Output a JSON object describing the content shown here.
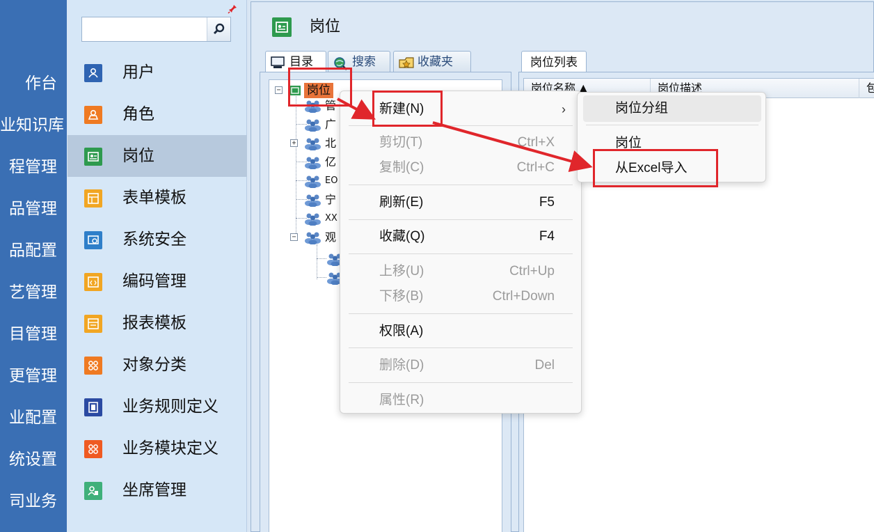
{
  "left_nav": {
    "items": [
      "作台",
      "业知识库",
      "程管理",
      "品管理",
      "品配置",
      "艺管理",
      "目管理",
      "更管理",
      "业配置",
      "统设置",
      "司业务"
    ]
  },
  "module_panel": {
    "search": {
      "value": "",
      "placeholder": ""
    },
    "modules": [
      {
        "label": "用户",
        "icon": "user-icon",
        "color": "#2f64b2"
      },
      {
        "label": "角色",
        "icon": "role-icon",
        "color": "#ef7a22"
      },
      {
        "label": "岗位",
        "icon": "position-icon",
        "color": "#2e9a4e"
      },
      {
        "label": "表单模板",
        "icon": "form-template-icon",
        "color": "#f1a623"
      },
      {
        "label": "系统安全",
        "icon": "security-icon",
        "color": "#2f7fc9"
      },
      {
        "label": "编码管理",
        "icon": "code-icon",
        "color": "#f1a623"
      },
      {
        "label": "报表模板",
        "icon": "report-template-icon",
        "color": "#f1a623"
      },
      {
        "label": "对象分类",
        "icon": "category-icon",
        "color": "#ef7a22"
      },
      {
        "label": "业务规则定义",
        "icon": "rule-icon",
        "color": "#2b4aa2"
      },
      {
        "label": "业务模块定义",
        "icon": "module-icon",
        "color": "#ef5a22"
      },
      {
        "label": "坐席管理",
        "icon": "seat-icon",
        "color": "#3fb07a"
      }
    ]
  },
  "content": {
    "title": "岗位",
    "left_tabs": [
      {
        "label": "目录",
        "icon": "catalog-icon"
      },
      {
        "label": "搜索",
        "icon": "search-globe-icon"
      },
      {
        "label": "收藏夹",
        "icon": "favorites-icon"
      }
    ],
    "tree": {
      "root": "岗位",
      "children": [
        "管",
        "广",
        "北",
        "亿",
        "EO",
        "宁",
        "XX",
        "观"
      ],
      "grandchildren": [
        "",
        ""
      ]
    },
    "right_tab": "岗位列表",
    "grid_columns": [
      "岗位名称 ▲",
      "岗位描述",
      "包"
    ]
  },
  "context_menu": {
    "items": [
      {
        "label": "新建(N)",
        "shortcut": "",
        "disabled": false,
        "submenu": true
      },
      {
        "label": "剪切(T)",
        "shortcut": "Ctrl+X",
        "disabled": true
      },
      {
        "label": "复制(C)",
        "shortcut": "Ctrl+C",
        "disabled": true
      },
      {
        "label": "刷新(E)",
        "shortcut": "F5",
        "disabled": false
      },
      {
        "label": "收藏(Q)",
        "shortcut": "F4",
        "disabled": false
      },
      {
        "label": "上移(U)",
        "shortcut": "Ctrl+Up",
        "disabled": true
      },
      {
        "label": "下移(B)",
        "shortcut": "Ctrl+Down",
        "disabled": true
      },
      {
        "label": "权限(A)",
        "shortcut": "",
        "disabled": false
      },
      {
        "label": "删除(D)",
        "shortcut": "Del",
        "disabled": true
      },
      {
        "label": "属性(R)",
        "shortcut": "",
        "disabled": true
      }
    ],
    "submenu_arrow": "›",
    "submenu": [
      "岗位分组",
      "岗位",
      "从Excel导入"
    ]
  },
  "annotation_color": "#e0262b"
}
